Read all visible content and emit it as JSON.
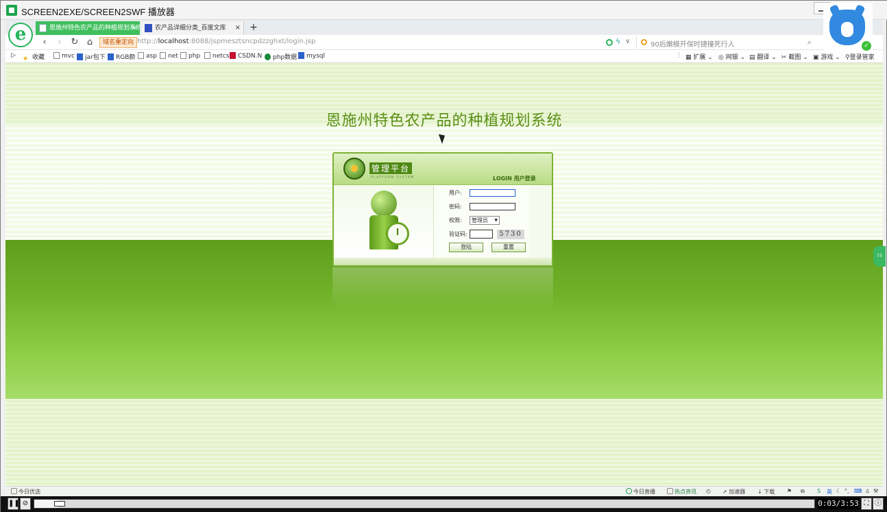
{
  "window": {
    "title": "SCREEN2EXE/SCREEN2SWF 播放器"
  },
  "browser": {
    "tabs": [
      {
        "label": "恩施州特色农产品的种植规划系统",
        "active": true
      },
      {
        "label": "农产品详细分类_百度文库",
        "active": false
      }
    ],
    "new_tab": "+",
    "tab_close": "×",
    "redirect_badge": "域名重定向",
    "url_prefix": "http://",
    "url_host": "localhost",
    "url_rest": ":8088/jspmesztsncpdzzghxt/login.jsp",
    "search_placeholder": "90后嫩模开保时捷撞死行人",
    "bookmarks": [
      {
        "label": "收藏",
        "icon": "star-icon"
      },
      {
        "label": "mvc",
        "icon": "page-icon"
      },
      {
        "label": "jar包下",
        "icon": "page-icon"
      },
      {
        "label": "RGB颜",
        "icon": "page-icon"
      },
      {
        "label": "asp",
        "icon": "page-icon"
      },
      {
        "label": "net",
        "icon": "page-icon"
      },
      {
        "label": "php",
        "icon": "page-icon"
      },
      {
        "label": "netcs",
        "icon": "page-icon"
      },
      {
        "label": "CSDN.N",
        "icon": "csdn-icon"
      },
      {
        "label": "php数据",
        "icon": "page-icon"
      },
      {
        "label": "mysql",
        "icon": "page-icon"
      }
    ],
    "toolbar_right": [
      {
        "label": "扩展"
      },
      {
        "label": "网银"
      },
      {
        "label": "翻译"
      },
      {
        "label": "截图"
      },
      {
        "label": "游戏"
      },
      {
        "label": "登录管家"
      }
    ]
  },
  "page": {
    "title": "恩施州特色农产品的种植规划系统",
    "login_panel": {
      "platform_title": "管理平台",
      "platform_sub": "PLATFORM SYSTEM",
      "login_label": "LOGIN 用户登录",
      "user_label": "用户:",
      "password_label": "密码:",
      "role_label": "权限:",
      "role_value": "管理员",
      "captcha_label": "验证码:",
      "captcha_code": "5730",
      "login_button": "登陆",
      "reset_button": "重置"
    },
    "side_badge": "73"
  },
  "statusbar": {
    "left": "今日优选",
    "items": [
      {
        "label": "今日直播"
      },
      {
        "label": "热点资讯"
      },
      {
        "label": "加速器"
      },
      {
        "label": "下载"
      }
    ],
    "ime_label": "英"
  },
  "player": {
    "time": "0:03/3:53",
    "progress": 0.013
  },
  "colors": {
    "page_title": "#5a8f16",
    "green_band": "#71b22a",
    "active_tab": "#3fbf5d"
  }
}
